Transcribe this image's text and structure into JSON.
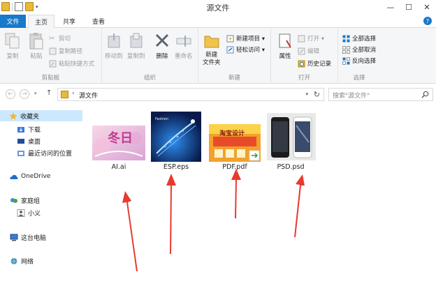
{
  "window": {
    "title": "源文件",
    "minimize": "—",
    "maximize": "☐",
    "close": "✕"
  },
  "tabs": {
    "file": "文件",
    "home": "主页",
    "share": "共享",
    "view": "查看",
    "help": "?"
  },
  "ribbon": {
    "clipboard": {
      "label": "剪贴板",
      "copy": "复制",
      "paste": "粘贴",
      "cut": "剪切",
      "copy_path": "复制路径",
      "paste_shortcut": "粘贴快捷方式"
    },
    "organize": {
      "label": "组织",
      "move_to": "移动到",
      "copy_to": "复制到",
      "delete": "删除",
      "rename": "重命名"
    },
    "new": {
      "label": "新建",
      "new_folder": "新建\n文件夹",
      "new_item": "新建项目 ▾",
      "easy_access": "轻松访问 ▾"
    },
    "open": {
      "label": "打开",
      "properties": "属性",
      "open": "打开 ▾",
      "edit": "编辑",
      "history": "历史记录"
    },
    "select": {
      "label": "选择",
      "select_all": "全部选择",
      "select_none": "全部取消",
      "invert": "反向选择"
    }
  },
  "address": {
    "separator": "›",
    "path": "源文件",
    "search_placeholder": "搜索\"源文件\""
  },
  "sidebar": {
    "favorites": "收藏夹",
    "downloads": "下载",
    "desktop": "桌面",
    "recent": "最近访问的位置",
    "onedrive": "OneDrive",
    "homegroup": "家庭组",
    "user": "小义",
    "this_pc": "这台电脑",
    "network": "网络"
  },
  "files": [
    {
      "name": "AI.ai",
      "thumb_text": "冬日"
    },
    {
      "name": "ESP.eps",
      "thumb_text": "Fashion"
    },
    {
      "name": "PDF.pdf",
      "thumb_text": "淘宝设计"
    },
    {
      "name": "PSD.psd",
      "thumb_text": ""
    }
  ],
  "colors": {
    "accent": "#1979ca",
    "arrow_red": "#e83a2e",
    "folder": "#e9b93a",
    "selection": "#cce8ff"
  }
}
